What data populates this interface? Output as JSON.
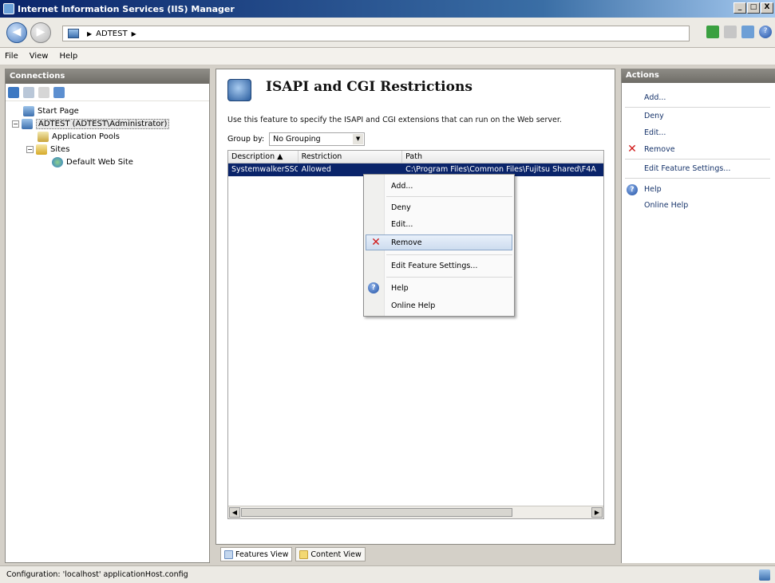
{
  "window": {
    "title": "Internet Information Services (IIS) Manager",
    "btn_min": "_",
    "btn_max": "□",
    "btn_close": "X"
  },
  "address": {
    "nav_back": "◀",
    "nav_fwd": "▶",
    "path": [
      "ADTEST"
    ],
    "arrow": "▶"
  },
  "menu": {
    "items": [
      "File",
      "View",
      "Help"
    ]
  },
  "connections": {
    "header": "Connections",
    "tree": [
      {
        "label": "Start Page",
        "level": 1
      },
      {
        "label": "ADTEST (ADTEST\\Administrator)",
        "level": 1,
        "expander": "−"
      },
      {
        "label": "Application Pools",
        "level": 2
      },
      {
        "label": "Sites",
        "level": 2,
        "expander": "−"
      },
      {
        "label": "Default Web Site",
        "level": 3
      }
    ]
  },
  "feature": {
    "title": "ISAPI and CGI Restrictions",
    "description": "Use this feature to specify the ISAPI and CGI extensions that can run on the Web server.",
    "group_by_label": "Group by:",
    "group_by_value": "No Grouping",
    "dropdown_glyph": "▼",
    "columns": [
      "Description ▲",
      "Restriction",
      "Path"
    ],
    "rows": [
      {
        "description": "SystemwalkerSSO",
        "restriction": "Allowed",
        "path": "C:\\Program Files\\Common Files\\Fujitsu Shared\\F4A"
      }
    ],
    "scroll_left": "◀",
    "scroll_right": "▶"
  },
  "view_tabs": {
    "features": "Features View",
    "content": "Content View"
  },
  "context_menu": {
    "items": [
      {
        "label": "Add...",
        "icon": ""
      },
      {
        "label": "Deny",
        "icon": ""
      },
      {
        "label": "Edit...",
        "icon": ""
      },
      {
        "label": "Remove",
        "icon": "x-icon",
        "glyph": "✕"
      },
      {
        "label": "Edit Feature Settings...",
        "icon": ""
      },
      {
        "label": "Help",
        "icon": "help-icon",
        "glyph": "?"
      },
      {
        "label": "Online Help",
        "icon": ""
      }
    ]
  },
  "actions": {
    "header": "Actions",
    "items": [
      "Add...",
      "Deny",
      "Edit...",
      "Remove",
      "Edit Feature Settings...",
      "Help",
      "Online Help"
    ],
    "remove_glyph": "✕",
    "help_glyph": "?"
  },
  "status": {
    "text": "Configuration: 'localhost' applicationHost.config"
  },
  "colors": {
    "selection": "#0a246a",
    "link": "#17346b",
    "remove_red": "#d01818"
  }
}
